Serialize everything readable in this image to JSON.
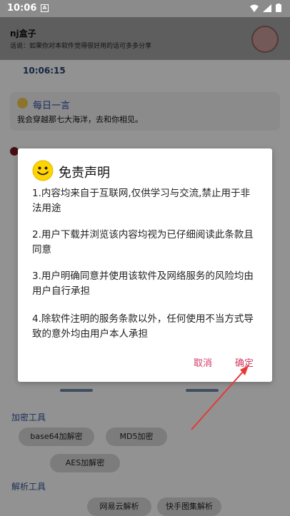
{
  "status": {
    "time": "10:06"
  },
  "header": {
    "title": "nj盒子",
    "subtitle": "话说：如果你对本软件觉得很好用的话可多多分享"
  },
  "clock": "10:06:15",
  "daily": {
    "title": "每日一言",
    "quote": "我会穿越那七大海洋，去和你相见。"
  },
  "sections": {
    "encryption": {
      "title": "加密工具",
      "items": [
        "base64加解密",
        "MD5加密",
        "AES加解密"
      ]
    },
    "parsing": {
      "title": "解析工具",
      "items": [
        "网易云解析",
        "快手图集解析"
      ]
    }
  },
  "dialog": {
    "title": "免责声明",
    "rules": [
      "1.内容均来自于互联网,仅供学习与交流,禁止用于非法用途",
      "2.用户下载并浏览该内容均视为已仔细阅读此条款且同意",
      "3.用户明确同意并使用该软件及网络服务的风险均由用户自行承担",
      "4.除软件注明的服务条款以外，任何使用不当方式导致的意外均由用户本人承担"
    ],
    "cancel": "取消",
    "confirm": "确定"
  },
  "colors": {
    "accent": "#d33a63",
    "arrow": "#e53935"
  }
}
